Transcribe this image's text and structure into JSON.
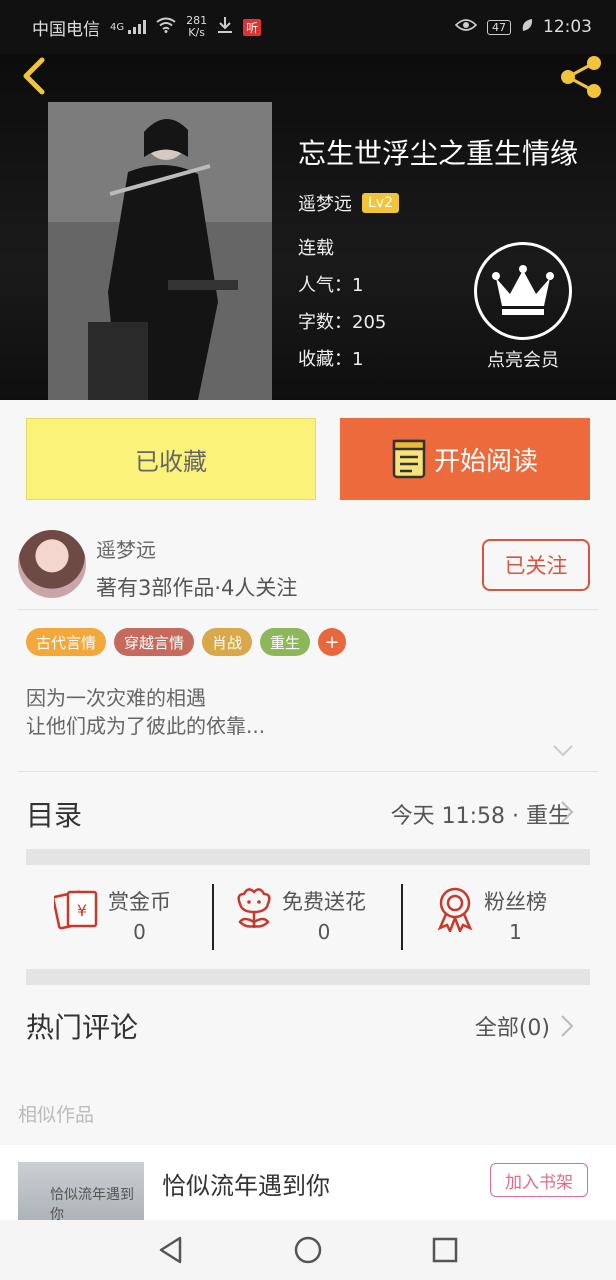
{
  "status_bar": {
    "carrier": "中国电信",
    "network": "4G",
    "speed_value": "281",
    "speed_unit": "K/s",
    "listen_badge": "听",
    "battery": "47",
    "time": "12:03"
  },
  "book": {
    "title": "忘生世浮尘之重生情缘",
    "author": "遥梦远",
    "level": "Lv2",
    "status": "连载",
    "popularity": "人气：1",
    "words": "字数：205",
    "favorites": "收藏：1"
  },
  "vip": {
    "label": "点亮会员"
  },
  "actions": {
    "collected_label": "已收藏",
    "read_label": "开始阅读"
  },
  "author_card": {
    "name": "遥梦远",
    "stats": "著有3部作品·4人关注",
    "follow_label": "已关注"
  },
  "tags": [
    {
      "label": "古代言情",
      "color": "#f2a83b"
    },
    {
      "label": "穿越言情",
      "color": "#c56a5c"
    },
    {
      "label": "肖战",
      "color": "#d8a84a"
    },
    {
      "label": "重生",
      "color": "#8cb85a"
    }
  ],
  "tag_add_label": "+",
  "synopsis": {
    "line1": "因为一次灾难的相遇",
    "line2": "让他们成为了彼此的依靠..."
  },
  "catalog": {
    "title": "目录",
    "latest": "今天 11:58 · 重生"
  },
  "stats": {
    "reward": {
      "label": "赏金币",
      "value": "0"
    },
    "flower": {
      "label": "免费送花",
      "value": "0"
    },
    "fans": {
      "label": "粉丝榜",
      "value": "1"
    }
  },
  "comments": {
    "title": "热门评论",
    "all_label": "全部(0)"
  },
  "similar": {
    "title": "相似作品",
    "item_title": "恰似流年遇到你",
    "item_cover_text": "恰似流年遇到你",
    "shelf_label": "加入书架"
  },
  "colors": {
    "accent_orange": "#ec6a3c",
    "collected_yellow": "#fbf27a",
    "follow_red": "#d9543d",
    "icon_red": "#c9382a"
  }
}
